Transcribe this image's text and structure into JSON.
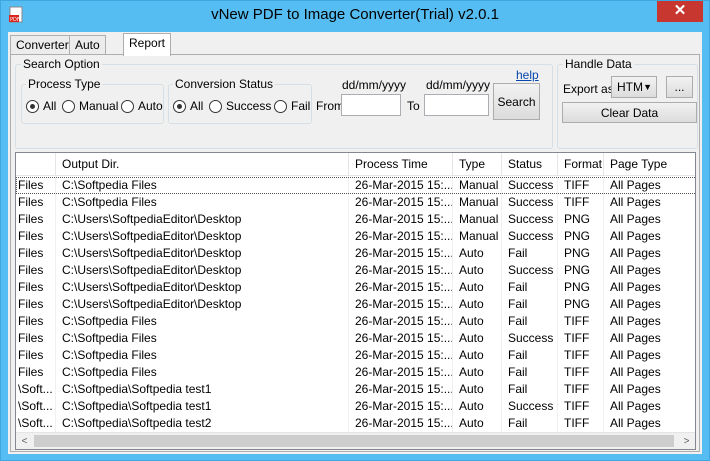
{
  "window": {
    "title": "vNew PDF to Image Converter(Trial) v2.0.1",
    "close_glyph": "✕"
  },
  "tabs": [
    "Converter",
    "Auto Job",
    "Report"
  ],
  "active_tab": "Report",
  "search": {
    "group_label": "Search Option",
    "help_link": "help",
    "process_type": {
      "label": "Process Type",
      "options": [
        "All",
        "Manual",
        "Auto"
      ],
      "selected": "All"
    },
    "conversion_status": {
      "label": "Conversion Status",
      "options": [
        "All",
        "Success",
        "Fail"
      ],
      "selected": "All"
    },
    "date_format_from": "dd/mm/yyyy",
    "date_format_to": "dd/mm/yyyy",
    "from_label": "From",
    "to_label": "To",
    "from_value": "",
    "to_value": "",
    "search_button": "Search"
  },
  "handle": {
    "group_label": "Handle Data",
    "export_label": "Export as",
    "export_value": "HTM",
    "browse_button": "...",
    "clear_button": "Clear Data"
  },
  "grid": {
    "columns": [
      "",
      "Output Dir.",
      "Process Time",
      "Type",
      "Status",
      "Format",
      "Page Type"
    ],
    "rows": [
      [
        "Files",
        "C:\\Softpedia Files",
        "26-Mar-2015 15:...",
        "Manual",
        "Success",
        "TIFF",
        "All Pages"
      ],
      [
        "Files",
        "C:\\Softpedia Files",
        "26-Mar-2015 15:...",
        "Manual",
        "Success",
        "TIFF",
        "All Pages"
      ],
      [
        "Files",
        "C:\\Users\\SoftpediaEditor\\Desktop",
        "26-Mar-2015 15:...",
        "Manual",
        "Success",
        "PNG",
        "All Pages"
      ],
      [
        "Files",
        "C:\\Users\\SoftpediaEditor\\Desktop",
        "26-Mar-2015 15:...",
        "Manual",
        "Success",
        "PNG",
        "All Pages"
      ],
      [
        "Files",
        "C:\\Users\\SoftpediaEditor\\Desktop",
        "26-Mar-2015 15:...",
        "Auto",
        "Fail",
        "PNG",
        "All Pages"
      ],
      [
        "Files",
        "C:\\Users\\SoftpediaEditor\\Desktop",
        "26-Mar-2015 15:...",
        "Auto",
        "Success",
        "PNG",
        "All Pages"
      ],
      [
        "Files",
        "C:\\Users\\SoftpediaEditor\\Desktop",
        "26-Mar-2015 15:...",
        "Auto",
        "Fail",
        "PNG",
        "All Pages"
      ],
      [
        "Files",
        "C:\\Users\\SoftpediaEditor\\Desktop",
        "26-Mar-2015 15:...",
        "Auto",
        "Fail",
        "PNG",
        "All Pages"
      ],
      [
        "Files",
        "C:\\Softpedia Files",
        "26-Mar-2015 15:...",
        "Auto",
        "Fail",
        "TIFF",
        "All Pages"
      ],
      [
        "Files",
        "C:\\Softpedia Files",
        "26-Mar-2015 15:...",
        "Auto",
        "Success",
        "TIFF",
        "All Pages"
      ],
      [
        "Files",
        "C:\\Softpedia Files",
        "26-Mar-2015 15:...",
        "Auto",
        "Fail",
        "TIFF",
        "All Pages"
      ],
      [
        "Files",
        "C:\\Softpedia Files",
        "26-Mar-2015 15:...",
        "Auto",
        "Fail",
        "TIFF",
        "All Pages"
      ],
      [
        "\\Soft...",
        "C:\\Softpedia\\Softpedia test1",
        "26-Mar-2015 15:...",
        "Auto",
        "Fail",
        "TIFF",
        "All Pages"
      ],
      [
        "\\Soft...",
        "C:\\Softpedia\\Softpedia test1",
        "26-Mar-2015 15:...",
        "Auto",
        "Success",
        "TIFF",
        "All Pages"
      ],
      [
        "\\Soft...",
        "C:\\Softpedia\\Softpedia test2",
        "26-Mar-2015 15:...",
        "Auto",
        "Fail",
        "TIFF",
        "All Pages"
      ],
      [
        "\\Soft...",
        "C:\\Softpedia\\Softpedia test2",
        "26-Mar-2015 15:...",
        "Auto",
        "Success",
        "TIFF",
        "All Pages"
      ]
    ]
  },
  "scroll": {
    "left": "<",
    "right": ">"
  },
  "colors": {
    "titlebar": "#56bdf2",
    "close": "#c7372f",
    "link": "#0645ad"
  }
}
